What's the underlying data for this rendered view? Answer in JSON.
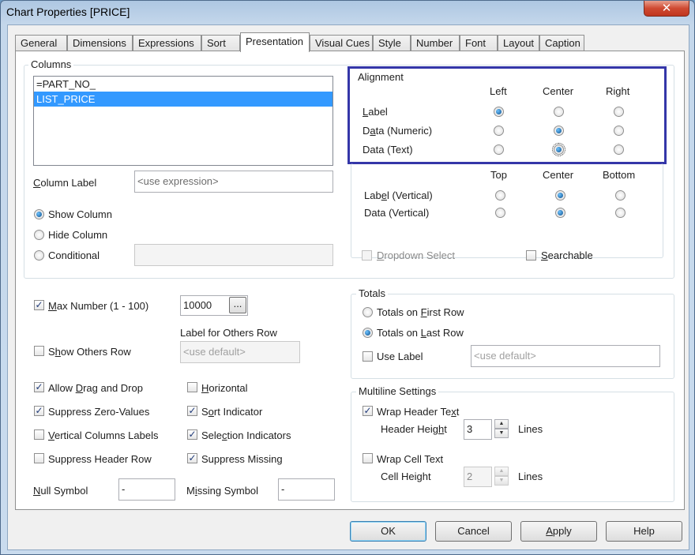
{
  "window": {
    "title": "Chart Properties [PRICE]",
    "close_glyph": "✕"
  },
  "tabs": [
    "General",
    "Dimensions",
    "Expressions",
    "Sort",
    "Presentation",
    "Visual Cues",
    "Style",
    "Number",
    "Font",
    "Layout",
    "Caption"
  ],
  "columns": {
    "title": "Columns",
    "items": [
      "=PART_NO_",
      "LIST_PRICE"
    ],
    "selected": "LIST_PRICE",
    "column_label": "Column Label",
    "column_label_placeholder": "<use expression>",
    "show_column": "Show Column",
    "hide_column": "Hide Column",
    "conditional": "Conditional"
  },
  "alignment": {
    "title": "Alignment",
    "headers": [
      "Left",
      "Center",
      "Right"
    ],
    "rows": [
      "Label",
      "Data (Numeric)",
      "Data (Text)"
    ],
    "v_headers": [
      "Top",
      "Center",
      "Bottom"
    ],
    "v_rows": [
      "Label (Vertical)",
      "Data (Vertical)"
    ]
  },
  "dropdown_select": "Dropdown Select",
  "searchable": "Searchable",
  "max_number": {
    "label": "Max Number (1 - 100)",
    "value": "10000",
    "browse": "..."
  },
  "others": {
    "label_title": "Label for Others Row",
    "placeholder": "<use default>",
    "show_others_row": "Show Others Row"
  },
  "options": {
    "allow_drag_drop": "Allow Drag and Drop",
    "suppress_zero": "Suppress Zero-Values",
    "vertical_labels": "Vertical Columns Labels",
    "suppress_header": "Suppress Header Row",
    "horizontal": "Horizontal",
    "sort_indicator": "Sort Indicator",
    "selection_indicators": "Selection Indicators",
    "suppress_missing": "Suppress Missing"
  },
  "symbols": {
    "null_label": "Null Symbol",
    "null_value": "-",
    "missing_label": "Missing Symbol",
    "missing_value": "-"
  },
  "totals": {
    "title": "Totals",
    "first_row": "Totals on First Row",
    "last_row": "Totals on Last Row",
    "use_label": "Use Label",
    "placeholder": "<use default>"
  },
  "multiline": {
    "title": "Multiline Settings",
    "wrap_header": "Wrap Header Text",
    "header_height": "Header Height",
    "header_height_value": "3",
    "lines": "Lines",
    "wrap_cell": "Wrap Cell Text",
    "cell_height": "Cell Height",
    "cell_height_value": "2"
  },
  "buttons": {
    "ok": "OK",
    "cancel": "Cancel",
    "apply": "Apply",
    "help": "Help"
  },
  "glyphs": {
    "check": "✓",
    "up": "▲",
    "down": "▼"
  }
}
